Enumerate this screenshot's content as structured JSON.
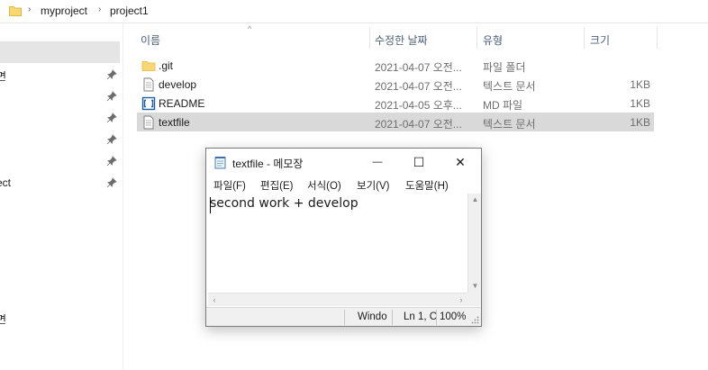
{
  "address": {
    "folder_icon": "folder-icon",
    "separator": "›",
    "crumbs": [
      "myproject",
      "project1"
    ]
  },
  "nav": {
    "items": [
      {
        "label": "면",
        "pinned": true
      },
      {
        "label": "",
        "pinned": true
      },
      {
        "label": "",
        "pinned": true
      },
      {
        "label": "",
        "pinned": true
      },
      {
        "label": "",
        "pinned": true
      },
      {
        "label": "ect",
        "pinned": true
      },
      {
        "label": "면",
        "pinned": false
      }
    ]
  },
  "columns": {
    "name": "이름",
    "date": "수정한 날짜",
    "type": "유형",
    "size": "크기",
    "sort_indicator": "^"
  },
  "files": [
    {
      "name": ".git",
      "date": "2021-04-07 오전...",
      "type": "파일 폴더",
      "size": "",
      "icon": "folder-icon",
      "selected": false
    },
    {
      "name": "develop",
      "date": "2021-04-07 오전...",
      "type": "텍스트 문서",
      "size": "1KB",
      "icon": "text-file-icon",
      "selected": false
    },
    {
      "name": "README",
      "date": "2021-04-05 오후...",
      "type": "MD 파일",
      "size": "1KB",
      "icon": "md-file-icon",
      "selected": false
    },
    {
      "name": "textfile",
      "date": "2021-04-07 오전...",
      "type": "텍스트 문서",
      "size": "1KB",
      "icon": "text-file-icon",
      "selected": true
    }
  ],
  "notepad": {
    "title": "textfile - 메모장",
    "icon": "notepad-icon",
    "controls": {
      "minimize": "—",
      "maximize": "☐",
      "close": "✕"
    },
    "menu": [
      "파일(F)",
      "편집(E)",
      "서식(O)",
      "보기(V)",
      "도움말(H)"
    ],
    "content": "second work + develop",
    "status": {
      "line_ending": "Windo",
      "position": "Ln 1, C",
      "zoom": "100%"
    }
  },
  "colors": {
    "selection": "#d9d9d9",
    "header_text": "#4c607a",
    "folder": "#f8d775"
  }
}
